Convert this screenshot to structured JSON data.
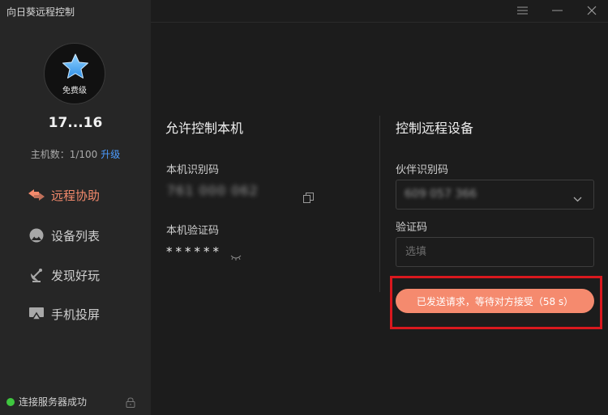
{
  "app": {
    "title": "向日葵远程控制"
  },
  "account": {
    "tier": "免费级",
    "user_id": "17...16",
    "host_count": "主机数：1/100",
    "upgrade": "升级"
  },
  "nav": {
    "remote_assist": "远程协助",
    "device_list": "设备列表",
    "discover": "发现好玩",
    "phone_mirror": "手机投屏"
  },
  "status": {
    "text": "连接服务器成功",
    "color": "#3fc63f"
  },
  "local": {
    "title": "允许控制本机",
    "id_label": "本机识别码",
    "id_value": "761 000 062",
    "code_label": "本机验证码",
    "code_value": "******"
  },
  "remote": {
    "title": "控制远程设备",
    "partner_label": "伙伴识别码",
    "partner_value": "609 057 366",
    "code_label": "验证码",
    "code_placeholder": "选填",
    "button_label": "已发送请求，等待对方接受（58 s）"
  },
  "colors": {
    "accent": "#f48a6c",
    "button": "#f58a6e",
    "link": "#4c9cff",
    "highlight": "#d9181e"
  }
}
